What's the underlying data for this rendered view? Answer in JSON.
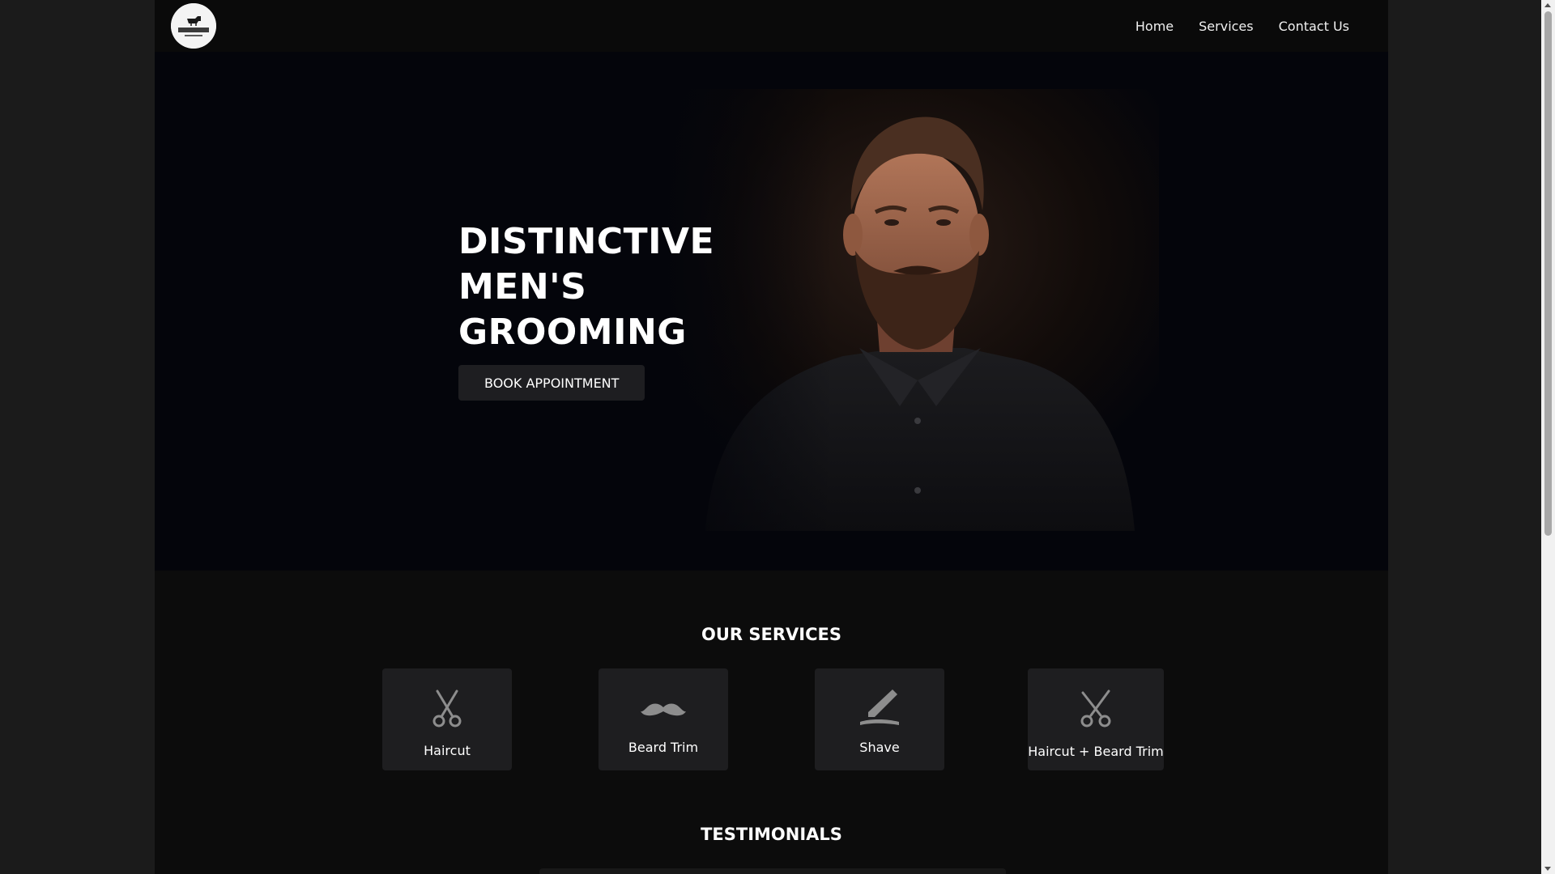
{
  "nav": {
    "logo_icon": "fade-and-blade-barbers-logo",
    "items": [
      "Home",
      "Services",
      "Contact Us"
    ]
  },
  "hero": {
    "title_lines": [
      "DISTINCTIVE",
      "MEN'S",
      "GROOMING"
    ],
    "cta_label": "BOOK APPOINTMENT",
    "image": "bearded-man-portrait"
  },
  "services": {
    "title": "OUR SERVICES",
    "items": [
      {
        "label": "Haircut",
        "icon": "scissors-icon"
      },
      {
        "label": "Beard Trim",
        "icon": "mustache-icon"
      },
      {
        "label": "Shave",
        "icon": "razor-icon"
      },
      {
        "label": "Haircut + Beard Trim",
        "icon": "scissors-crossed-icon"
      }
    ]
  },
  "testimonials": {
    "title": "TESTIMONIALS"
  },
  "colors": {
    "page_background": "#0b0b0b",
    "outer_background": "#1b1b1b",
    "card_background": "#1e1e20",
    "button_background": "#1e1e21",
    "icon_color": "#8d8d8d"
  }
}
